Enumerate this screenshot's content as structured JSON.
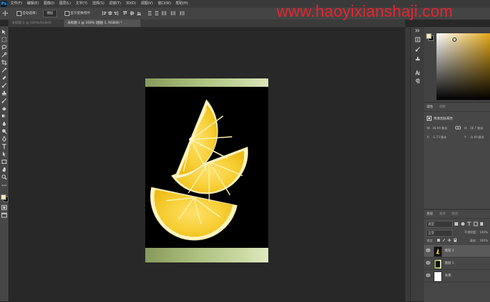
{
  "watermark": "www.haoyixianshaji.com",
  "app": {
    "logo": "Ps"
  },
  "menu": [
    "文件(F)",
    "编辑(E)",
    "图像(I)",
    "图层(L)",
    "文字(Y)",
    "选择(S)",
    "滤镜(T)",
    "3D(D)",
    "视图(V)",
    "窗口(W)",
    "帮助(H)"
  ],
  "options": {
    "auto_select": "自动选择：",
    "auto_select_target": "图层",
    "show_transform": "显示变换控件"
  },
  "tabs": [
    {
      "label": "未标题-1 @ 100%(RGB/8)",
      "active": false
    },
    {
      "label": "未标题-1 @ 100% (图层 1, RGB/8) *",
      "active": true
    }
  ],
  "tools": [
    "move-tool-icon",
    "marquee-tool-icon",
    "lasso-tool-icon",
    "quick-select-tool-icon",
    "crop-tool-icon",
    "eyedropper-tool-icon",
    "healing-tool-icon",
    "brush-tool-icon",
    "stamp-tool-icon",
    "history-brush-icon",
    "eraser-tool-icon",
    "gradient-tool-icon",
    "blur-tool-icon",
    "dodge-tool-icon",
    "pen-tool-icon",
    "type-tool-icon",
    "path-select-tool-icon",
    "shape-tool-icon",
    "hand-tool-icon",
    "zoom-tool-icon"
  ],
  "colors": {
    "foreground": "#f2e9b8",
    "background": "#000000",
    "accent": "#e3a91a",
    "watermark": "#e8232e"
  },
  "properties": {
    "tabs": [
      "属性",
      "调整"
    ],
    "title": "像素图层属性",
    "w_label": "W:",
    "w_value": "36.69 厘米",
    "h_label": "H:",
    "h_value": "18.7 厘米",
    "x_label": "X:",
    "x_value": "-1.73 厘米",
    "y_label": "Y:",
    "y_value": "-0.49 厘米"
  },
  "layers": {
    "tabs": [
      "图层",
      "通道",
      "路径"
    ],
    "kind": "类型",
    "blend_mode": "正常",
    "opacity_label": "不透明度:",
    "opacity_value": "100%",
    "lock_label": "锁定:",
    "fill_label": "填充:",
    "fill_value": "100%",
    "items": [
      {
        "name": "图层 2",
        "selected": true
      },
      {
        "name": "图层 1",
        "selected": false
      },
      {
        "name": "背景",
        "selected": false
      }
    ]
  }
}
